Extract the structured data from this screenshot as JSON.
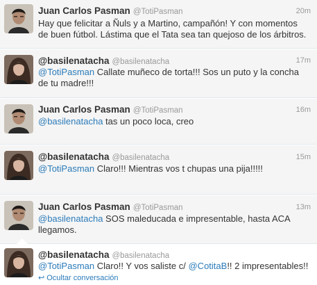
{
  "tweets": [
    {
      "name": "Juan Carlos Pasman",
      "handle": "@TotiPasman",
      "time": "20m",
      "lines": [
        [
          {
            "t": "Hay que felicitar a Ñuls y a Martino, campañón! Y con momentos"
          }
        ],
        [
          {
            "t": "de buen fútbol. Lástima que el Tata sea tan quejoso de los árbitros."
          }
        ]
      ],
      "avatar": "man-photo"
    },
    {
      "name": "@basilenatacha",
      "handle": "@basilenatacha",
      "time": "17m",
      "lines": [
        [
          {
            "t": "@TotiPasman",
            "m": true
          },
          {
            "t": " Callate muñeco de torta!!! Sos un puto y la concha"
          }
        ],
        [
          {
            "t": "de tu madre!!!"
          }
        ]
      ],
      "avatar": "woman-photo"
    },
    {
      "name": "Juan Carlos Pasman",
      "handle": "@TotiPasman",
      "time": "16m",
      "lines": [
        [
          {
            "t": "@basilenatacha",
            "m": true
          },
          {
            "t": " tas un poco loca, creo"
          }
        ]
      ],
      "avatar": "man-photo"
    },
    {
      "name": "@basilenatacha",
      "handle": "@basilenatacha",
      "time": "15m",
      "lines": [
        [
          {
            "t": "@TotiPasman",
            "m": true
          },
          {
            "t": " Claro!!! Mientras vos t chupas una pija!!!!!"
          }
        ]
      ],
      "avatar": "woman-photo"
    },
    {
      "name": "Juan Carlos Pasman",
      "handle": "@TotiPasman",
      "time": "13m",
      "lines": [
        [
          {
            "t": "@basilenatacha",
            "m": true
          },
          {
            "t": " SOS maleducada e impresentable, hasta ACA"
          }
        ],
        [
          {
            "t": "llegamos."
          }
        ]
      ],
      "avatar": "man-photo"
    },
    {
      "name": "@basilenatacha",
      "handle": "@basilenatacha",
      "time": "",
      "lines": [
        [
          {
            "t": "@TotiPasman",
            "m": true
          },
          {
            "t": " Claro!! Y vos saliste c/ "
          },
          {
            "t": "@CotitaB",
            "m": true
          },
          {
            "t": "!! 2 impresentables!!"
          }
        ]
      ],
      "avatar": "woman-photo"
    }
  ],
  "collapse_label": "Ocultar conversación",
  "collapse_icon": "return-arrow-icon",
  "colors": {
    "mention": "#2b7bb9",
    "tweet_bg": "#f5f5f5",
    "meta_text": "#999999"
  }
}
